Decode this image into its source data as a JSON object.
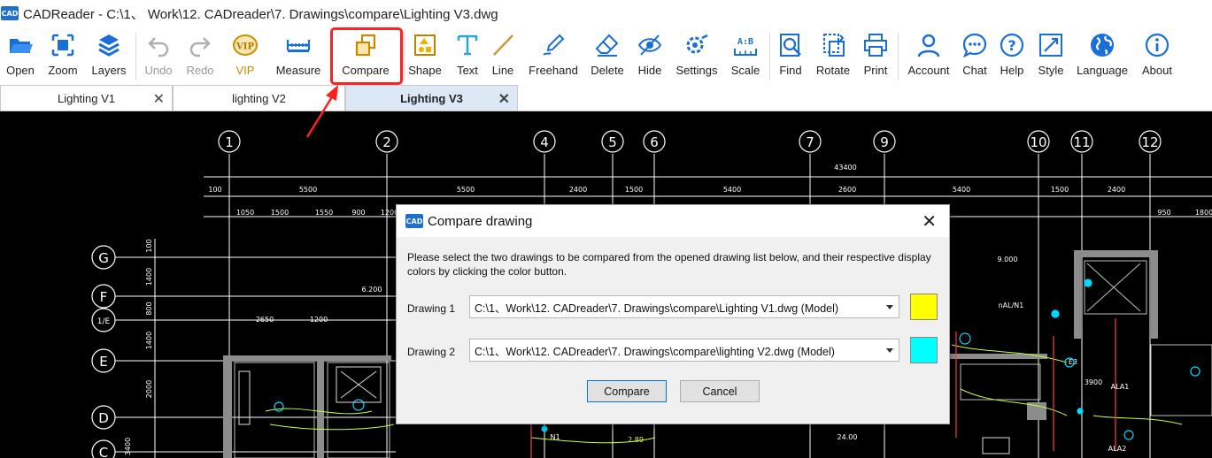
{
  "app": {
    "logo_text": "CAD",
    "title": "CADReader - C:\\1、 Work\\12. CADreader\\7. Drawings\\compare\\Lighting V3.dwg"
  },
  "toolbar": {
    "items": [
      {
        "label": "Open",
        "icon": "open-folder-icon"
      },
      {
        "label": "Zoom",
        "icon": "zoom-icon"
      },
      {
        "label": "Layers",
        "icon": "layers-icon"
      },
      {
        "label": "Undo",
        "icon": "undo-icon"
      },
      {
        "label": "Redo",
        "icon": "redo-icon"
      },
      {
        "label": "VIP",
        "icon": "vip-icon"
      },
      {
        "label": "Measure",
        "icon": "measure-icon"
      },
      {
        "label": "Compare",
        "icon": "compare-icon"
      },
      {
        "label": "Shape",
        "icon": "shape-icon"
      },
      {
        "label": "Text",
        "icon": "text-icon"
      },
      {
        "label": "Line",
        "icon": "line-icon"
      },
      {
        "label": "Freehand",
        "icon": "freehand-icon"
      },
      {
        "label": "Delete",
        "icon": "eraser-icon"
      },
      {
        "label": "Hide",
        "icon": "hide-icon"
      },
      {
        "label": "Settings",
        "icon": "settings-icon"
      },
      {
        "label": "Scale",
        "icon": "scale-icon"
      },
      {
        "label": "Find",
        "icon": "find-icon"
      },
      {
        "label": "Rotate",
        "icon": "rotate-icon"
      },
      {
        "label": "Print",
        "icon": "print-icon"
      },
      {
        "label": "Account",
        "icon": "account-icon"
      },
      {
        "label": "Chat",
        "icon": "chat-icon"
      },
      {
        "label": "Help",
        "icon": "help-icon"
      },
      {
        "label": "Style",
        "icon": "style-icon"
      },
      {
        "label": "Language",
        "icon": "globe-icon"
      },
      {
        "label": "About",
        "icon": "info-icon"
      }
    ],
    "vip_badge": "VIP",
    "scale_glyph": "A:B"
  },
  "tabs": [
    {
      "label": "Lighting V1",
      "active": false
    },
    {
      "label": "lighting V2",
      "active": false
    },
    {
      "label": "Lighting V3",
      "active": true
    }
  ],
  "drawing": {
    "axis_numbers": [
      "1",
      "2",
      "4",
      "5",
      "6",
      "7",
      "9",
      "10",
      "11",
      "12"
    ],
    "axis_letters": [
      "G",
      "F",
      "1/E",
      "E",
      "D",
      "C"
    ],
    "total_dim": "43400",
    "dims_row1": [
      "100",
      "5500",
      "5500",
      "2400",
      "1500",
      "5400",
      "2600",
      "5400",
      "1500",
      "2400"
    ],
    "dims_row2": [
      "1050",
      "1500",
      "1550",
      "900",
      "1200",
      "950",
      "1800"
    ],
    "left_dims": [
      "100",
      "1400",
      "800",
      "1400",
      "2000",
      "3400"
    ],
    "misc_labels": [
      "2650",
      "1200",
      "6.200",
      "9.000",
      "nAL/N1",
      "3900",
      "ALA1",
      "N1",
      "ALA2",
      "E3",
      "24.00",
      "2.89"
    ]
  },
  "dialog": {
    "logo_text": "CAD",
    "title": "Compare drawing",
    "description": "Please select the two drawings to be compared from the opened drawing list below, and their respective display colors by clicking the color button.",
    "drawing1_label": "Drawing 1",
    "drawing1_value": "C:\\1、Work\\12. CADreader\\7. Drawings\\compare\\Lighting V1.dwg (Model)",
    "drawing1_color": "#ffff00",
    "drawing2_label": "Drawing 2",
    "drawing2_value": "C:\\1、Work\\12. CADreader\\7. Drawings\\compare\\lighting V2.dwg (Model)",
    "drawing2_color": "#00ffff",
    "compare_label": "Compare",
    "cancel_label": "Cancel"
  }
}
